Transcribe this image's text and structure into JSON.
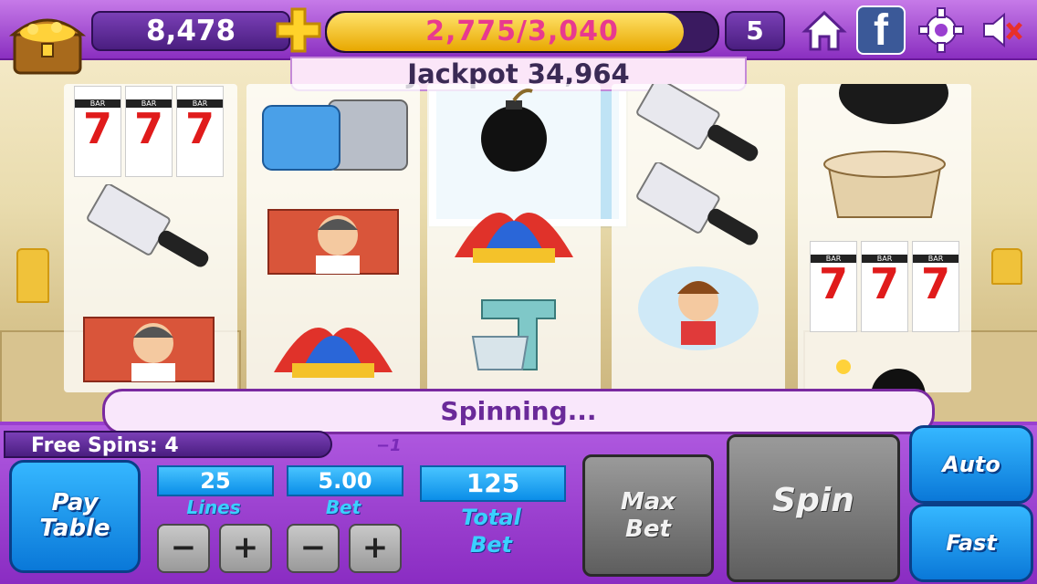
{
  "header": {
    "coins": "8,478",
    "xp_text": "2,775/3,040",
    "xp_progress": 0.913,
    "level": "5",
    "jackpot": "Jackpot 34,964"
  },
  "icons": [
    "treasure-chest-icon",
    "plus-icon",
    "home-icon",
    "facebook-icon",
    "gear-icon",
    "speaker-muted-icon"
  ],
  "facebook_letter": "f",
  "reels": [
    [
      "seven-bar-cherry",
      "cleaver",
      "chef-man"
    ],
    [
      "food-processor",
      "chef-man",
      "jester-hat"
    ],
    [
      "bomb",
      "jester-hat",
      "stand-mixer"
    ],
    [
      "cleaver",
      "cleaver",
      "chef-woman"
    ],
    [
      "frying-pan",
      "cooking-pot",
      "seven-bar-cherry",
      "bomb"
    ]
  ],
  "seven_symbol": {
    "bar": "BAR",
    "seven": "7"
  },
  "status": "Spinning...",
  "free_spins": "Free Spins: 4",
  "free_spins_delta": "−1",
  "controls": {
    "pay_table_line1": "Pay",
    "pay_table_line2": "Table",
    "lines_value": "25",
    "lines_label": "Lines",
    "bet_value": "5.00",
    "bet_label": "Bet",
    "total_bet_value": "125",
    "total_label_line1": "Total",
    "total_label_line2": "Bet",
    "minus": "−",
    "plus": "+",
    "max_bet_line1": "Max",
    "max_bet_line2": "Bet",
    "spin": "Spin",
    "auto": "Auto",
    "fast": "Fast"
  },
  "colors": {
    "accent": "#9a3fd0",
    "blue_button": "#1a9af0",
    "xp_fill": "#f2c21a",
    "xp_text": "#e83a8f"
  }
}
